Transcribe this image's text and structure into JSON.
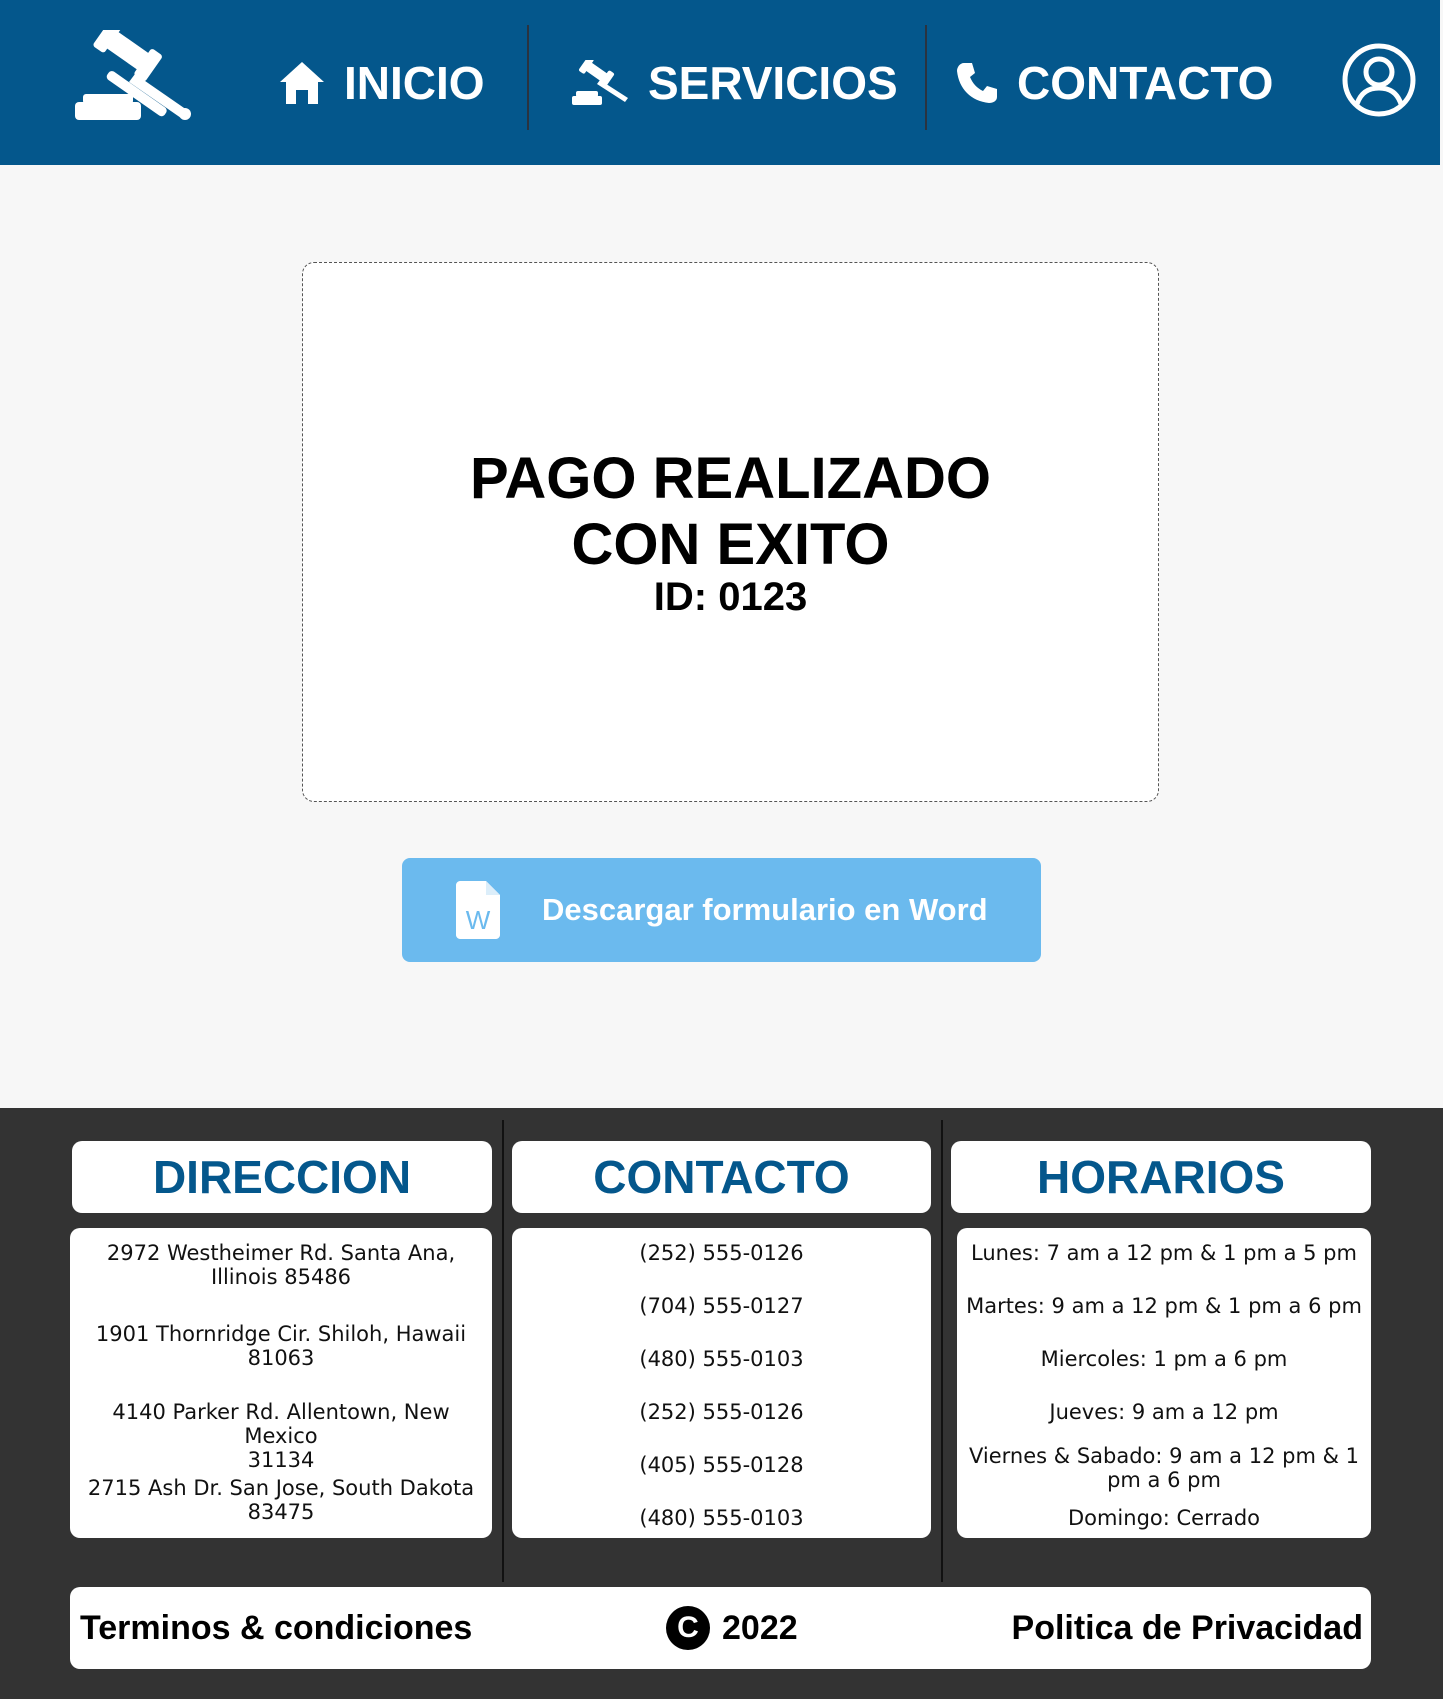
{
  "header": {
    "nav": [
      {
        "label": "INICIO",
        "icon": "home-icon"
      },
      {
        "label": "SERVICIOS",
        "icon": "gavel-icon"
      },
      {
        "label": "CONTACTO",
        "icon": "phone-icon"
      }
    ],
    "brand_color": "#04578c"
  },
  "main": {
    "title_line1": "PAGO REALIZADO",
    "title_line2": "CON EXITO",
    "payment_id": "ID: 0123",
    "download_label": "Descargar formulario en Word",
    "download_icon": "word-file-icon"
  },
  "footer": {
    "direccion": {
      "title": "DIRECCION",
      "items": [
        [
          "2972 Westheimer Rd. Santa Ana,",
          "Illinois 85486"
        ],
        [
          "1901 Thornridge Cir. Shiloh, Hawaii",
          "81063"
        ],
        [
          "4140 Parker Rd. Allentown, New Mexico",
          "31134"
        ],
        [
          "2715 Ash Dr. San Jose, South Dakota",
          "83475"
        ]
      ]
    },
    "contacto": {
      "title": "CONTACTO",
      "items": [
        "(252) 555-0126",
        "(704) 555-0127",
        "(480) 555-0103",
        "(252) 555-0126",
        "(405) 555-0128",
        "(480) 555-0103"
      ]
    },
    "horarios": {
      "title": "HORARIOS",
      "items": [
        [
          "Lunes: 7 am a 12 pm & 1 pm a 5 pm"
        ],
        [
          "Martes: 9 am a 12 pm & 1 pm a 6 pm"
        ],
        [
          "Miercoles: 1 pm a 6 pm"
        ],
        [
          "Jueves: 9 am a 12 pm"
        ],
        [
          "Viernes & Sabado: 9 am a 12 pm & 1",
          "pm a 6 pm"
        ],
        [
          "Domingo: Cerrado"
        ]
      ]
    },
    "bottom": {
      "terms": "Terminos & condiciones",
      "copyright_symbol": "C",
      "year": "2022",
      "privacy": "Politica de Privacidad"
    }
  }
}
